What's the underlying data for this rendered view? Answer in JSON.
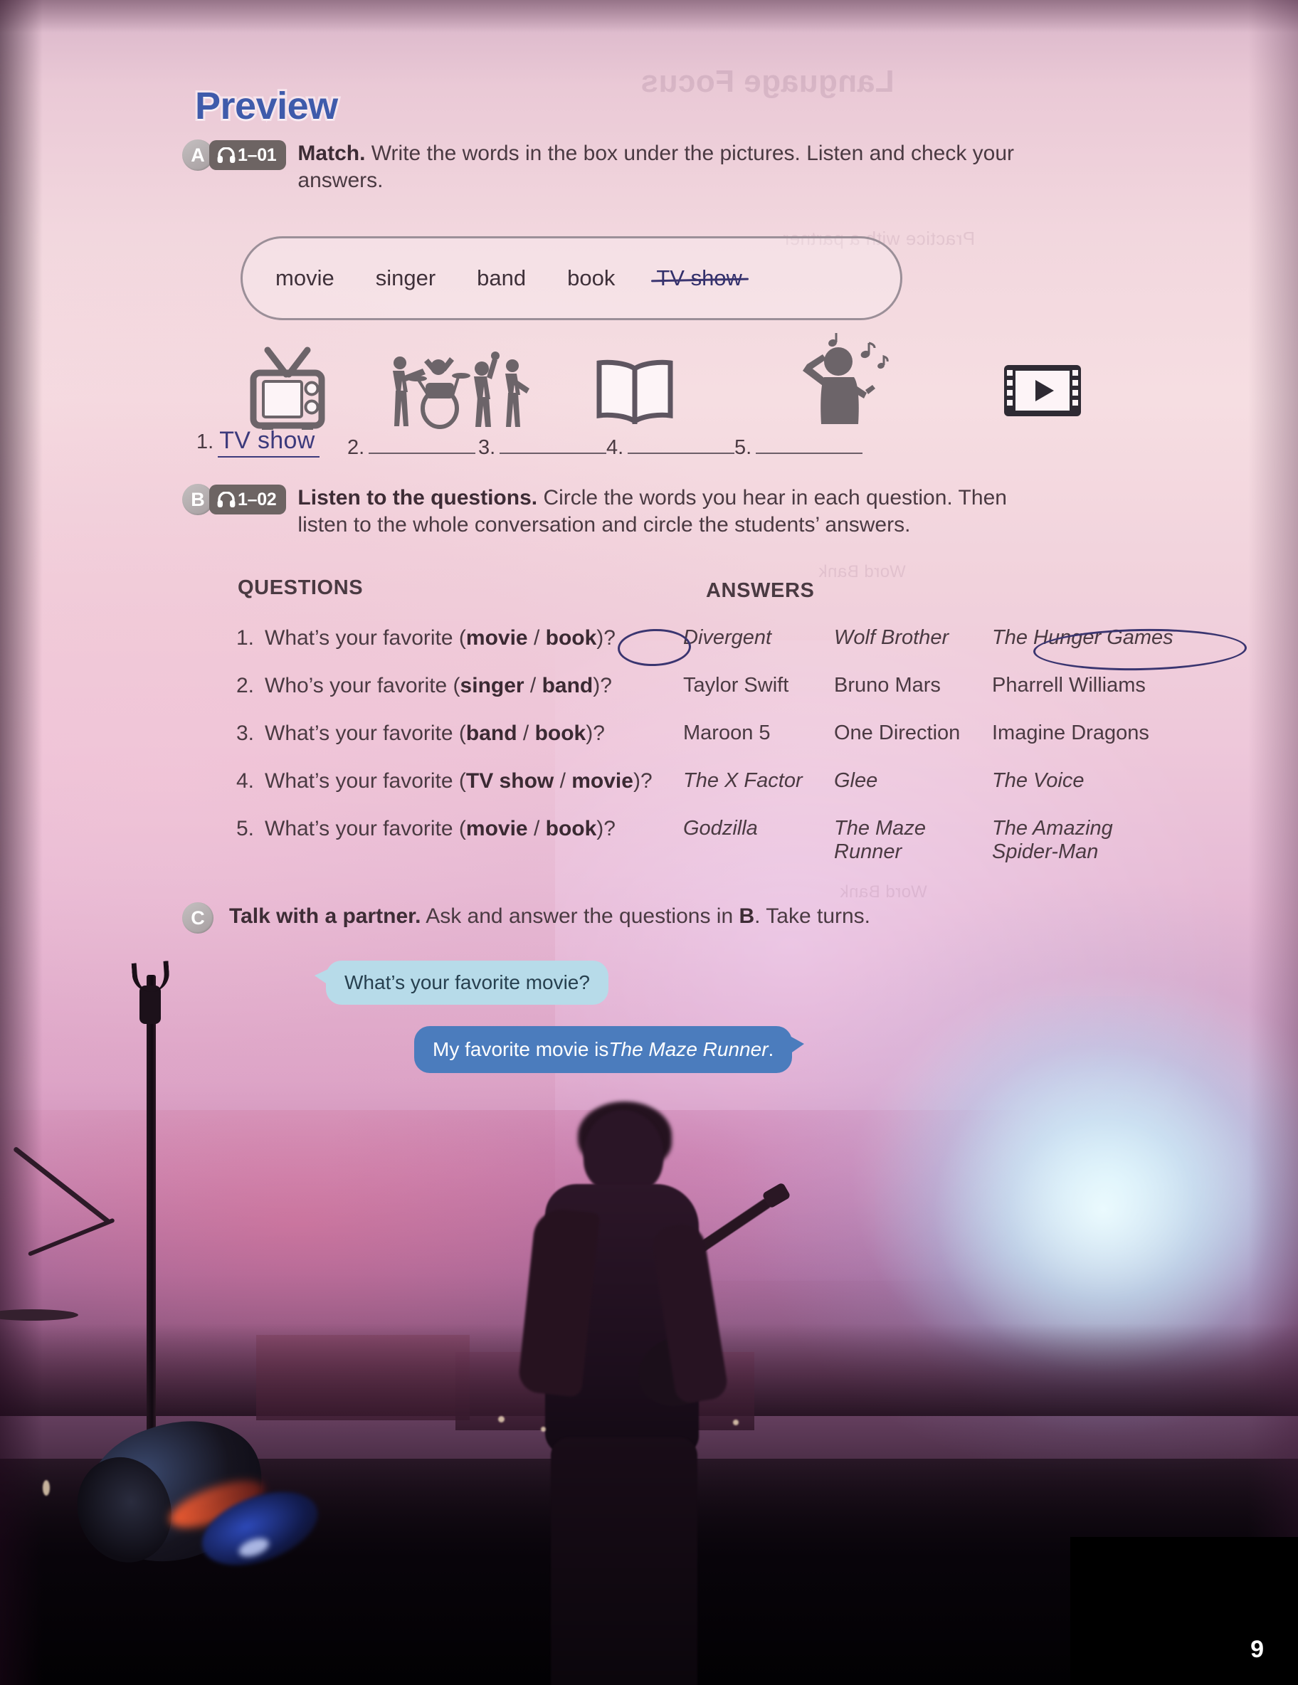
{
  "page": {
    "title": "Preview",
    "page_number": "9",
    "title_color": "#3f5bab",
    "ghost_text": "Language Focus"
  },
  "exercise_a": {
    "letter": "A",
    "audio_track": "1–01",
    "audio_icon": "headphones-icon",
    "instruction_bold": "Match.",
    "instruction_rest": " Write the words in the box under the pictures. Listen and check your answers.",
    "word_bank": [
      {
        "word": "movie",
        "struck": false
      },
      {
        "word": "singer",
        "struck": false
      },
      {
        "word": "band",
        "struck": false
      },
      {
        "word": "book",
        "struck": false
      },
      {
        "word": "TV show",
        "struck": true
      }
    ],
    "pictures": [
      {
        "number": "1.",
        "icon": "television-icon",
        "answer": "TV show",
        "filled": true
      },
      {
        "number": "2.",
        "icon": "band-icon",
        "answer": "",
        "filled": false
      },
      {
        "number": "3.",
        "icon": "open-book-icon",
        "answer": "",
        "filled": false
      },
      {
        "number": "4.",
        "icon": "singer-icon",
        "answer": "",
        "filled": false
      },
      {
        "number": "5.",
        "icon": "film-strip-play-icon",
        "answer": "",
        "filled": false
      }
    ]
  },
  "exercise_b": {
    "letter": "B",
    "audio_track": "1–02",
    "audio_icon": "headphones-icon",
    "instruction_bold": "Listen to the questions.",
    "instruction_rest": " Circle the words you hear in each question. Then listen to the whole conversation and circle the students’ answers.",
    "column_headers": {
      "questions": "QUESTIONS",
      "answers": "ANSWERS"
    },
    "rows": [
      {
        "num": "1.",
        "q_pre": "What’s your favorite (",
        "q_opt1": "movie",
        "q_sep": " / ",
        "q_opt2": "book",
        "q_post": ")?",
        "circled_option": "book",
        "answers": [
          "Divergent",
          "Wolf Brother",
          "The Hunger Games"
        ],
        "answers_italic": true,
        "circled_answer": "The Hunger Games"
      },
      {
        "num": "2.",
        "q_pre": "Who’s your favorite (",
        "q_opt1": "singer",
        "q_sep": " / ",
        "q_opt2": "band",
        "q_post": ")?",
        "circled_option": "",
        "answers": [
          "Taylor Swift",
          "Bruno Mars",
          "Pharrell Williams"
        ],
        "answers_italic": false,
        "circled_answer": ""
      },
      {
        "num": "3.",
        "q_pre": "What’s your favorite (",
        "q_opt1": "band",
        "q_sep": " / ",
        "q_opt2": "book",
        "q_post": ")?",
        "circled_option": "",
        "answers": [
          "Maroon 5",
          "One Direction",
          "Imagine Dragons"
        ],
        "answers_italic": false,
        "circled_answer": ""
      },
      {
        "num": "4.",
        "q_pre": "What’s your favorite (",
        "q_opt1": "TV show",
        "q_sep": " / ",
        "q_opt2": "movie",
        "q_post": ")?",
        "circled_option": "",
        "answers": [
          "The X Factor",
          "Glee",
          "The Voice"
        ],
        "answers_italic": true,
        "circled_answer": ""
      },
      {
        "num": "5.",
        "q_pre": "What’s your favorite (",
        "q_opt1": "movie",
        "q_sep": " / ",
        "q_opt2": "book",
        "q_post": ")?",
        "circled_option": "",
        "answers": [
          "Godzilla",
          "The Maze\nRunner",
          "The Amazing\nSpider-Man"
        ],
        "answers_italic": true,
        "circled_answer": ""
      }
    ]
  },
  "exercise_c": {
    "letter": "C",
    "instruction_bold": "Talk with a partner.",
    "instruction_mid": " Ask and answer the questions in ",
    "instruction_ref": "B",
    "instruction_end": ". Take turns.",
    "bubbles": [
      {
        "text": "What’s your favorite movie?",
        "style": "light",
        "color": "#b7dbe9",
        "tail": "left"
      },
      {
        "text_pre": "My favorite movie is ",
        "text_italic": "The Maze Runner",
        "text_post": ".",
        "style": "dark",
        "color": "#4b7cbd",
        "tail": "right"
      }
    ]
  }
}
